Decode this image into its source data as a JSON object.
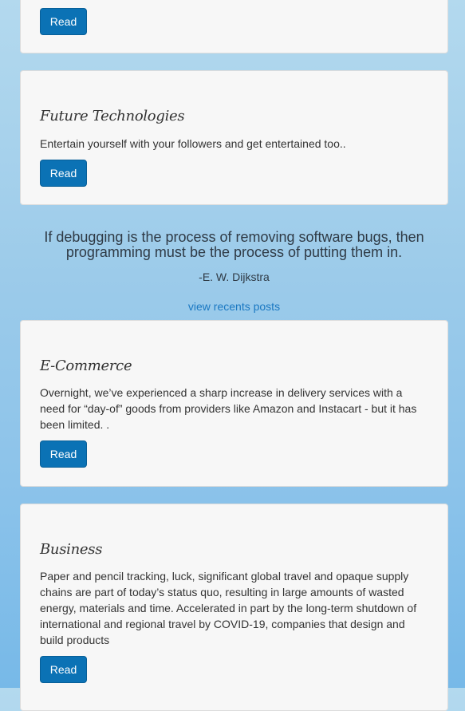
{
  "cards": [
    {
      "title": "",
      "text": "",
      "button": "Read"
    },
    {
      "title": "Future Technologies",
      "text": "Entertain yourself with your followers and get entertained too..",
      "button": "Read"
    },
    {
      "title": "E-Commerce",
      "text": "Overnight, we’ve experienced a sharp increase in delivery services with a need for “day-of” goods from providers like Amazon and Instacart - but it has been limited. .",
      "button": "Read"
    },
    {
      "title": "Business",
      "text": "Paper and pencil tracking, luck, significant global travel and opaque supply chains are part of today’s status quo, resulting in large amounts of wasted energy, materials and time. Accelerated in part by the long-term shutdown of international and regional travel by COVID-19, companies that design and build products",
      "button": "Read"
    }
  ],
  "quote": {
    "text": "If debugging is the process of removing software bugs, then programming must be the process of putting them in.",
    "author": "-E. W. Dijkstra"
  },
  "recent_link": "view recents posts",
  "colors": {
    "button": "#0b72b5",
    "link": "#1a78c2",
    "card_bg": "#f7f7f7"
  }
}
